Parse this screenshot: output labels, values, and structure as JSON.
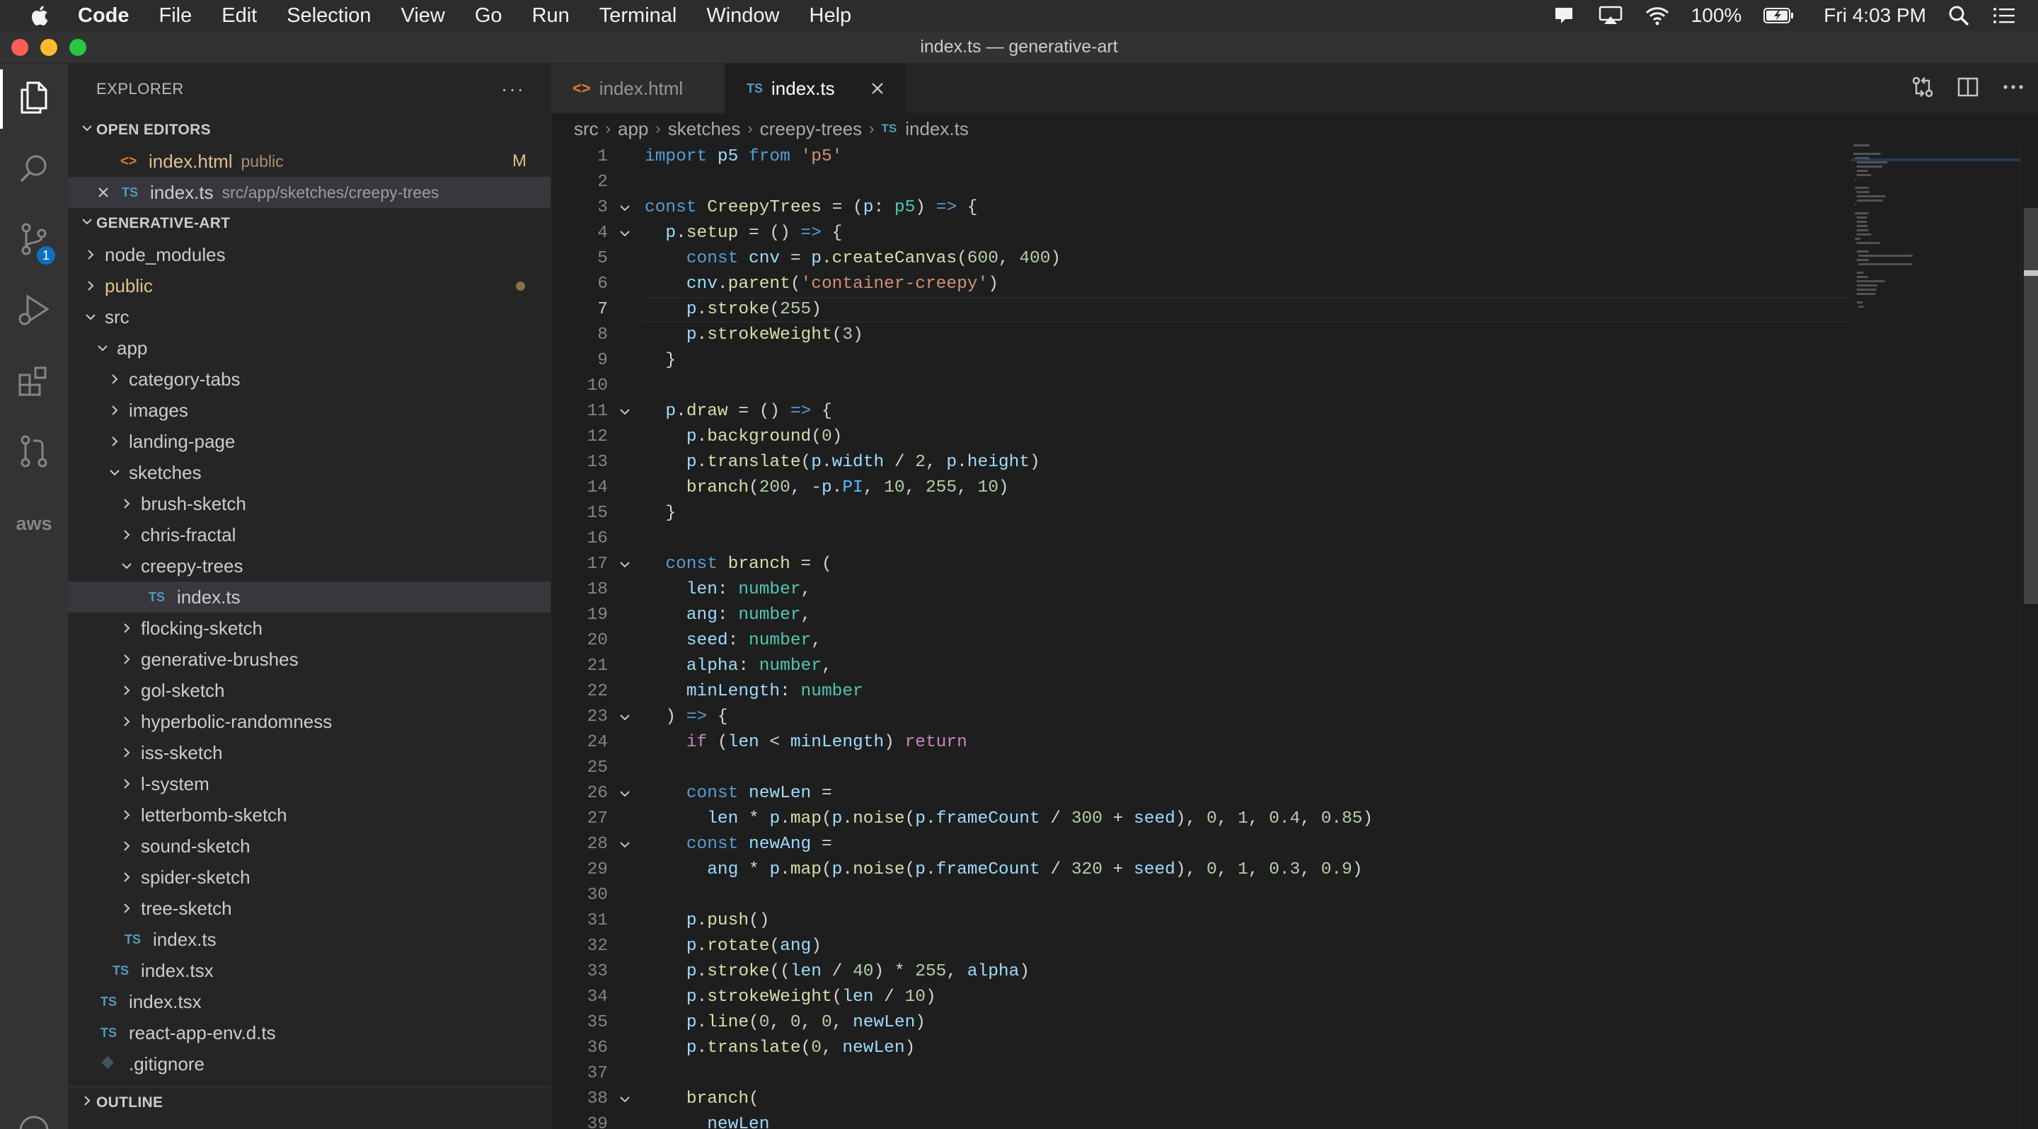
{
  "menubar": {
    "app": "Code",
    "items": [
      "File",
      "Edit",
      "Selection",
      "View",
      "Go",
      "Run",
      "Terminal",
      "Window",
      "Help"
    ],
    "battery": "100%",
    "clock": "Fri 4:03 PM"
  },
  "window": {
    "title": "index.ts — generative-art"
  },
  "activity": {
    "scm_badge": "1",
    "aws_label": "aws"
  },
  "explorer": {
    "title": "EXPLORER",
    "more": "···",
    "open_editors": {
      "title": "OPEN EDITORS",
      "items": [
        {
          "name": "index.html",
          "desc": "public",
          "status": "M"
        },
        {
          "name": "index.ts",
          "desc": "src/app/sketches/creepy-trees"
        }
      ]
    },
    "project": {
      "title": "GENERATIVE-ART",
      "tree": [
        {
          "label": "node_modules"
        },
        {
          "label": "public"
        },
        {
          "label": "src"
        },
        {
          "label": "app"
        },
        {
          "label": "category-tabs"
        },
        {
          "label": "images"
        },
        {
          "label": "landing-page"
        },
        {
          "label": "sketches"
        },
        {
          "label": "brush-sketch"
        },
        {
          "label": "chris-fractal"
        },
        {
          "label": "creepy-trees"
        },
        {
          "label": "index.ts"
        },
        {
          "label": "flocking-sketch"
        },
        {
          "label": "generative-brushes"
        },
        {
          "label": "gol-sketch"
        },
        {
          "label": "hyperbolic-randomness"
        },
        {
          "label": "iss-sketch"
        },
        {
          "label": "l-system"
        },
        {
          "label": "letterbomb-sketch"
        },
        {
          "label": "sound-sketch"
        },
        {
          "label": "spider-sketch"
        },
        {
          "label": "tree-sketch"
        },
        {
          "label": "index.ts"
        },
        {
          "label": "index.tsx"
        },
        {
          "label": "index.tsx"
        },
        {
          "label": "react-app-env.d.ts"
        },
        {
          "label": ".gitignore"
        }
      ]
    },
    "outline_title": "OUTLINE"
  },
  "tabs": [
    {
      "label": "index.html",
      "icon": "<>"
    },
    {
      "label": "index.ts",
      "icon": "TS"
    }
  ],
  "breadcrumbs": [
    "src",
    "app",
    "sketches",
    "creepy-trees",
    "index.ts"
  ],
  "breadcrumb_icon": "TS",
  "ts_icon": "TS",
  "html_icon": "<>",
  "code": {
    "line_numbers": [
      "1",
      "2",
      "3",
      "4",
      "5",
      "6",
      "7",
      "8",
      "9",
      "10",
      "11",
      "12",
      "13",
      "14",
      "15",
      "16",
      "17",
      "18",
      "19",
      "20",
      "21",
      "22",
      "23",
      "24",
      "25",
      "26",
      "27",
      "28",
      "29",
      "30",
      "31",
      "32",
      "33",
      "34",
      "35",
      "36",
      "37",
      "38",
      "39"
    ],
    "lines": [
      "import p5 from 'p5'",
      "",
      "const CreepyTrees = (p: p5) => {",
      "  p.setup = () => {",
      "    const cnv = p.createCanvas(600, 400)",
      "    cnv.parent('container-creepy')",
      "    p.stroke(255)",
      "    p.strokeWeight(3)",
      "  }",
      "",
      "  p.draw = () => {",
      "    p.background(0)",
      "    p.translate(p.width / 2, p.height)",
      "    branch(200, -p.PI, 10, 255, 10)",
      "  }",
      "",
      "  const branch = (",
      "    len: number,",
      "    ang: number,",
      "    seed: number,",
      "    alpha: number,",
      "    minLength: number",
      "  ) => {",
      "    if (len < minLength) return",
      "",
      "    const newLen =",
      "      len * p.map(p.noise(p.frameCount / 300 + seed), 0, 1, 0.4, 0.85)",
      "    const newAng =",
      "      ang * p.map(p.noise(p.frameCount / 320 + seed), 0, 1, 0.3, 0.9)",
      "",
      "    p.push()",
      "    p.rotate(ang)",
      "    p.stroke((len / 40) * 255, alpha)",
      "    p.strokeWeight(len / 10)",
      "    p.line(0, 0, 0, newLen)",
      "    p.translate(0, newLen)",
      "",
      "    branch(",
      "      newLen"
    ]
  }
}
